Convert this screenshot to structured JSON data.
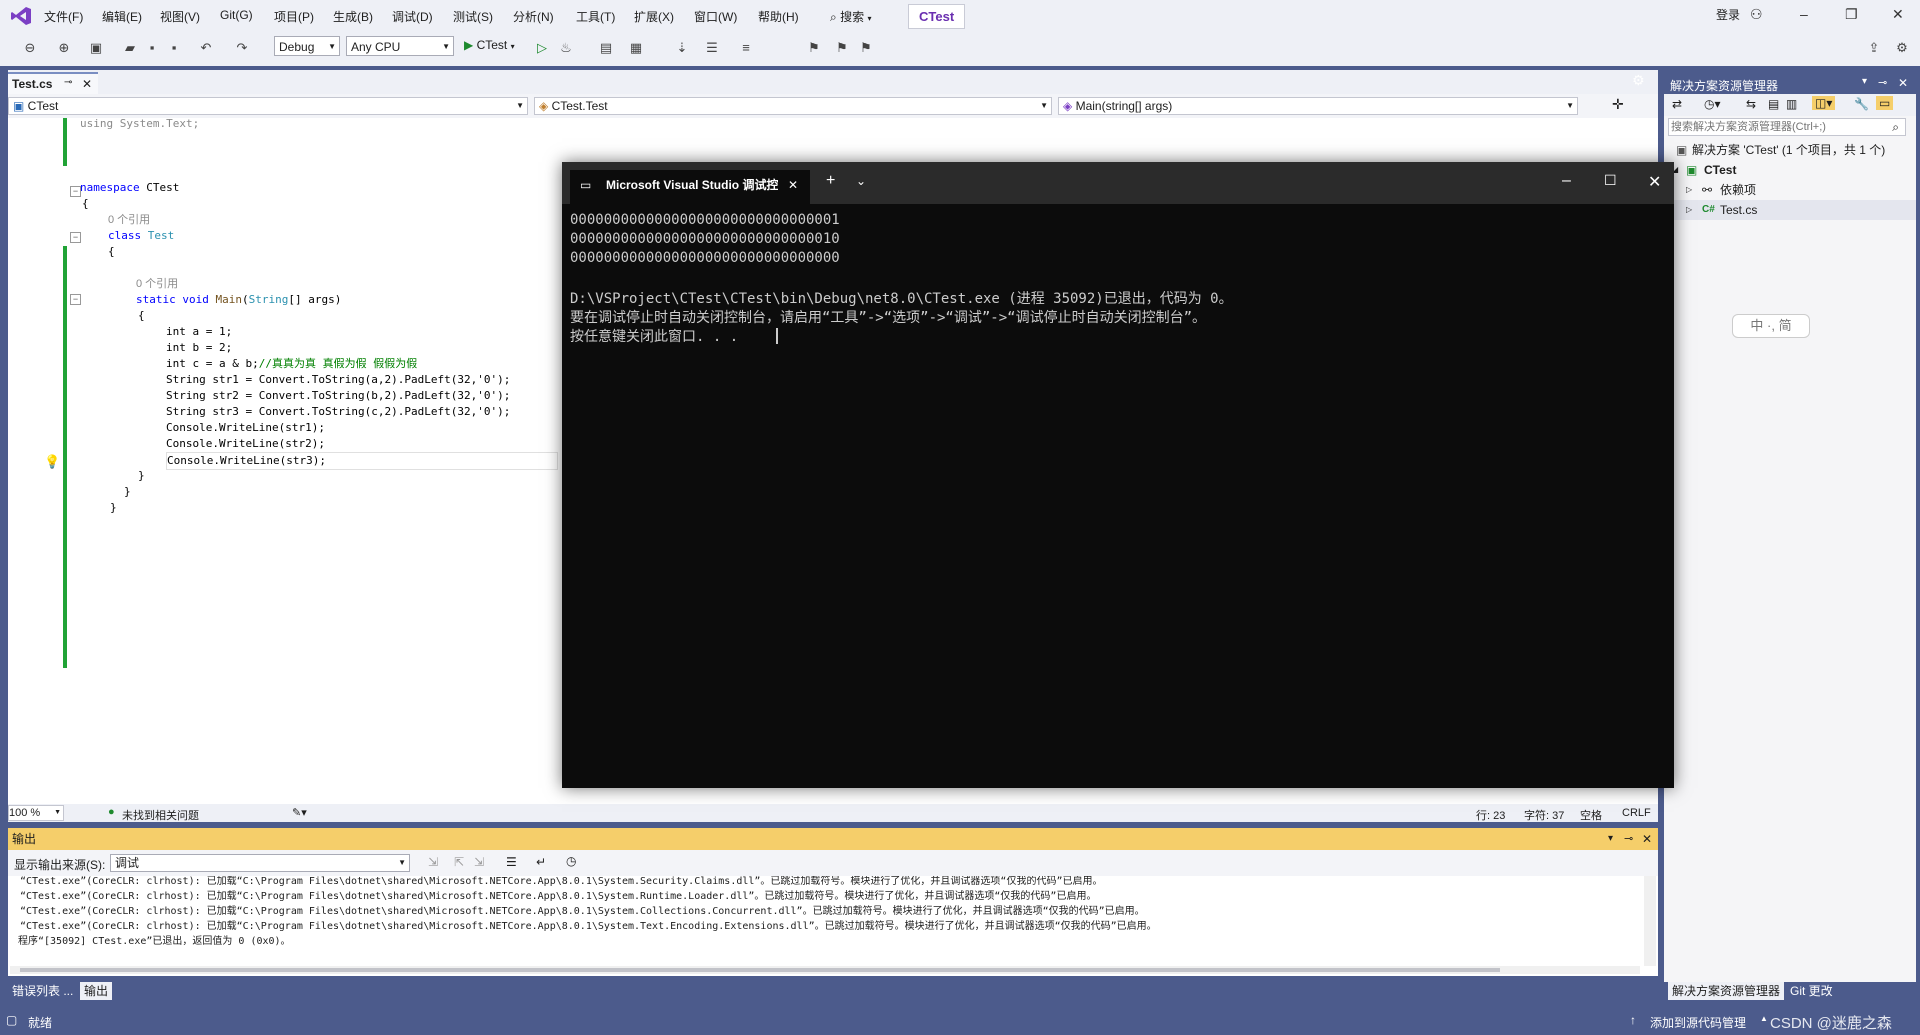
{
  "menu": [
    "文件(F)",
    "编辑(E)",
    "视图(V)",
    "Git(G)",
    "项目(P)",
    "生成(B)",
    "调试(D)",
    "测试(S)",
    "分析(N)",
    "工具(T)",
    "扩展(X)",
    "窗口(W)",
    "帮助(H)"
  ],
  "search_label": "搜索",
  "app_title": "CTest",
  "login_label": "登录",
  "toolbar": {
    "config": "Debug",
    "platform": "Any CPU",
    "run_label": "CTest"
  },
  "editor": {
    "tab": "Test.cs",
    "nav_project": "CTest",
    "nav_class": "CTest.Test",
    "nav_member": "Main(string[] args)",
    "zoom": "100 %",
    "issues": "未找到相关问题",
    "line": "行: 23",
    "col": "字符: 37",
    "spaces": "空格",
    "eol": "CRLF"
  },
  "code": {
    "l1": "using System.Text;",
    "l2_kw": "namespace",
    "l2_name": " CTest",
    "l3": "{",
    "ref1": "0 个引用",
    "l4_kw": "class",
    "l4_name": "Test",
    "l5": "{",
    "ref2": "0 个引用",
    "l6_kw": "static void",
    "l6_mt": "Main",
    "l6_ty": "String",
    "l6_rest": "[] args)",
    "l7": "{",
    "l8": "int a = 1;",
    "l9": "int b = 2;",
    "l10_code": "int c = a & b;",
    "l10_cm": "//真真为真 真假为假 假假为假",
    "l11": "String str1 = Convert.ToString(a,2).PadLeft(32,'0');",
    "l12": "String str2 = Convert.ToString(b,2).PadLeft(32,'0');",
    "l13": "String str3 = Convert.ToString(c,2).PadLeft(32,'0');",
    "l14": "Console.WriteLine(str1);",
    "l15": "Console.WriteLine(str2);",
    "l16": "Console.WriteLine(str3);",
    "l17": "}",
    "l18": "}",
    "l19": "}"
  },
  "console": {
    "tab_title": "Microsoft Visual Studio 调试控",
    "lines": [
      "00000000000000000000000000000001",
      "00000000000000000000000000000010",
      "00000000000000000000000000000000",
      "",
      "D:\\VSProject\\CTest\\CTest\\bin\\Debug\\net8.0\\CTest.exe (进程 35092)已退出，代码为 0。",
      "要在调试停止时自动关闭控制台，请启用“工具”->“选项”->“调试”->“调试停止时自动关闭控制台”。",
      "按任意键关闭此窗口. . ."
    ]
  },
  "solution_explorer": {
    "title": "解决方案资源管理器",
    "search_placeholder": "搜索解决方案资源管理器(Ctrl+;)",
    "solution": "解决方案 'CTest' (1 个项目，共 1 个)",
    "project": "CTest",
    "deps": "依赖项",
    "file": "Test.cs",
    "tab1": "解决方案资源管理器",
    "tab2": "Git 更改"
  },
  "ime": "中 ·, 简",
  "output": {
    "title": "输出",
    "source_label": "显示输出来源(S):",
    "source_value": "调试",
    "lines": [
      "“CTest.exe”(CoreCLR: clrhost): 已加载“C:\\Program Files\\dotnet\\shared\\Microsoft.NETCore.App\\8.0.1\\System.Security.Claims.dll”。已跳过加载符号。模块进行了优化，并且调试器选项“仅我的代码”已启用。",
      "“CTest.exe”(CoreCLR: clrhost): 已加载“C:\\Program Files\\dotnet\\shared\\Microsoft.NETCore.App\\8.0.1\\System.Runtime.Loader.dll”。已跳过加载符号。模块进行了优化，并且调试器选项“仅我的代码”已启用。",
      "“CTest.exe”(CoreCLR: clrhost): 已加载“C:\\Program Files\\dotnet\\shared\\Microsoft.NETCore.App\\8.0.1\\System.Collections.Concurrent.dll”。已跳过加载符号。模块进行了优化，并且调试器选项“仅我的代码”已启用。",
      "“CTest.exe”(CoreCLR: clrhost): 已加载“C:\\Program Files\\dotnet\\shared\\Microsoft.NETCore.App\\8.0.1\\System.Text.Encoding.Extensions.dll”。已跳过加载符号。模块进行了优化，并且调试器选项“仅我的代码”已启用。",
      "程序“[35092] CTest.exe”已退出，返回值为 0 (0x0)。"
    ],
    "tab_errors": "错误列表 ...",
    "tab_output": "输出"
  },
  "status": {
    "ready": "就绪",
    "add_source": "添加到源代码管理",
    "watermark": "CSDN @迷鹿之森"
  }
}
